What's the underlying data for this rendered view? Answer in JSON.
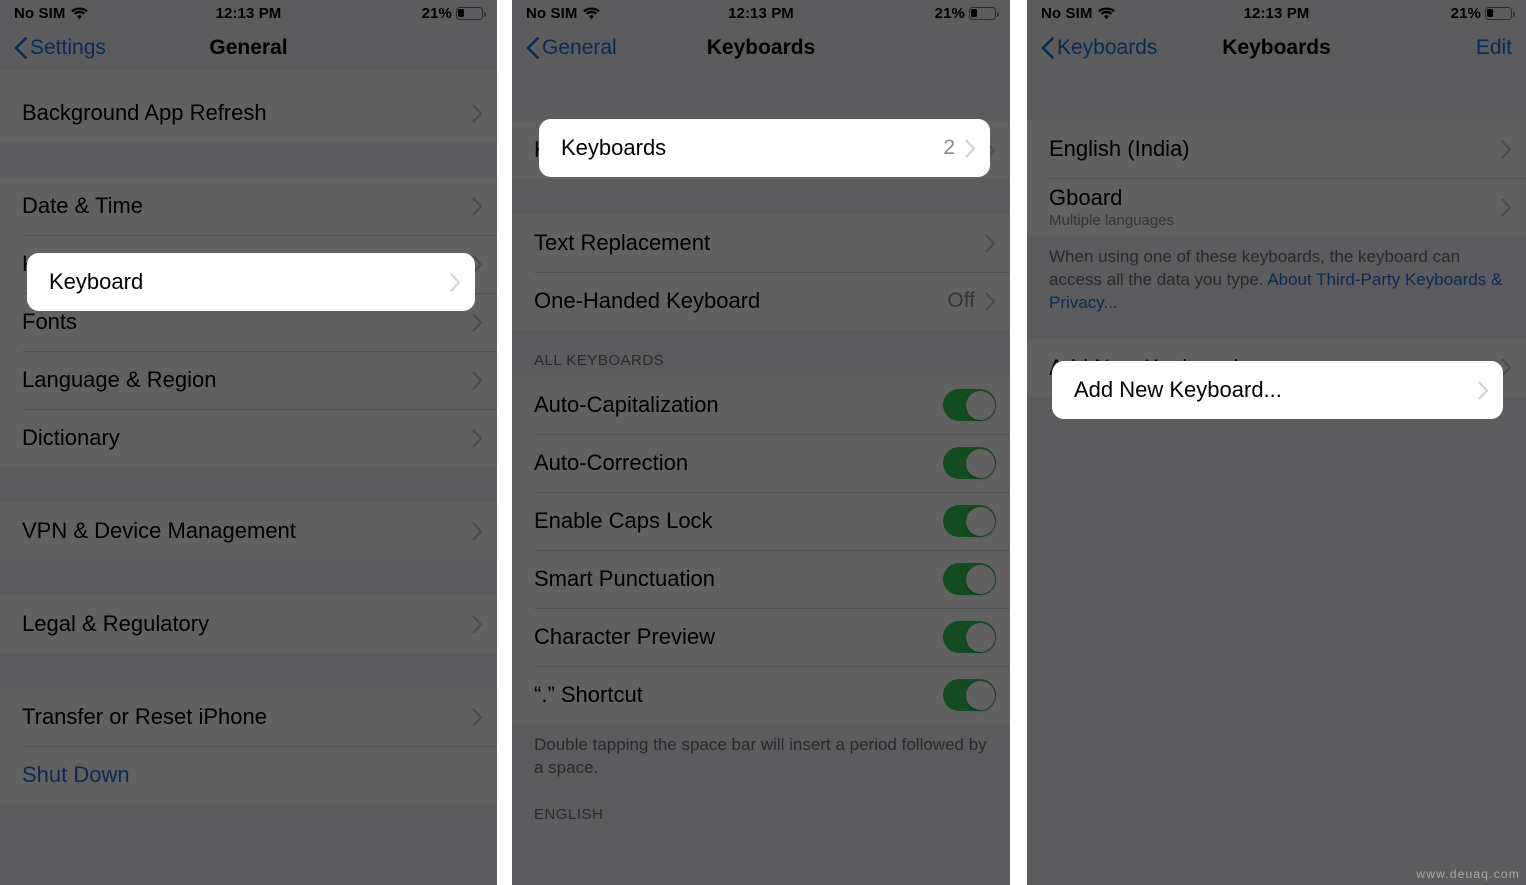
{
  "status_bar": {
    "carrier": "No SIM",
    "time": "12:13 PM",
    "battery_percent": "21%",
    "battery_level": 21,
    "wifi_icon": "wifi-icon",
    "battery_icon": "battery-icon"
  },
  "colors": {
    "accent_blue": "#1a6fd4",
    "toggle_green": "#34c759",
    "list_background": "#ffffff",
    "page_background": "#f2f2f7",
    "dim_overlay": "rgba(0,0,0,0.62)",
    "separator": "#d9d9dd",
    "secondary_text": "#8a8a8e"
  },
  "watermark": "www.deuaq.com",
  "panel1": {
    "nav": {
      "back_label": "Settings",
      "title": "General"
    },
    "sections": [
      {
        "rows": [
          {
            "label": "Background App Refresh",
            "accessory": "chevron"
          }
        ]
      },
      {
        "rows": [
          {
            "label": "Date & Time",
            "accessory": "chevron"
          },
          {
            "label": "Keyboard",
            "accessory": "chevron",
            "highlighted": true
          },
          {
            "label": "Fonts",
            "accessory": "chevron"
          },
          {
            "label": "Language & Region",
            "accessory": "chevron"
          },
          {
            "label": "Dictionary",
            "accessory": "chevron"
          }
        ]
      },
      {
        "rows": [
          {
            "label": "VPN & Device Management",
            "accessory": "chevron"
          }
        ]
      },
      {
        "rows": [
          {
            "label": "Legal & Regulatory",
            "accessory": "chevron"
          }
        ]
      },
      {
        "rows": [
          {
            "label": "Transfer or Reset iPhone",
            "accessory": "chevron"
          },
          {
            "label": "Shut Down",
            "accessory": "none",
            "style": "blue"
          }
        ]
      }
    ]
  },
  "panel2": {
    "nav": {
      "back_label": "General",
      "title": "Keyboards"
    },
    "sections": [
      {
        "rows": [
          {
            "label": "Keyboards",
            "value": "2",
            "accessory": "chevron",
            "highlighted": true
          }
        ]
      },
      {
        "rows": [
          {
            "label": "Text Replacement",
            "accessory": "chevron"
          },
          {
            "label": "One-Handed Keyboard",
            "value": "Off",
            "accessory": "chevron"
          }
        ]
      }
    ],
    "all_keyboards_header": "ALL KEYBOARDS",
    "toggles": [
      {
        "label": "Auto-Capitalization",
        "on": true
      },
      {
        "label": "Auto-Correction",
        "on": true
      },
      {
        "label": "Enable Caps Lock",
        "on": true
      },
      {
        "label": "Smart Punctuation",
        "on": true
      },
      {
        "label": "Character Preview",
        "on": true
      },
      {
        "label": "“.” Shortcut",
        "on": true
      }
    ],
    "footer_note": "Double tapping the space bar will insert a period followed by a space.",
    "english_header": "ENGLISH"
  },
  "panel3": {
    "nav": {
      "back_label": "Keyboards",
      "title": "Keyboards",
      "edit_label": "Edit"
    },
    "keyboards": [
      {
        "label": "English (India)",
        "sub": "",
        "accessory": "chevron"
      },
      {
        "label": "Gboard",
        "sub": "Multiple languages",
        "accessory": "chevron"
      }
    ],
    "privacy_note_part1": "When using one of these keyboards, the keyboard can access all the data you type. ",
    "privacy_note_link": "About Third-Party Keyboards & Privacy...",
    "add_row": {
      "label": "Add New Keyboard...",
      "accessory": "chevron",
      "highlighted": true
    }
  }
}
